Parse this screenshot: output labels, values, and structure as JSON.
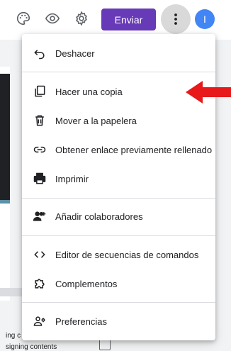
{
  "toolbar": {
    "send_label": "Enviar",
    "avatar_initial": "I",
    "accent_color": "#673ab7",
    "icons": [
      "palette-icon",
      "eye-icon",
      "gear-icon",
      "more-vert-icon"
    ]
  },
  "menu": {
    "items": [
      {
        "label": "Deshacer",
        "icon": "undo-icon"
      },
      {
        "label": "Hacer una copia",
        "icon": "copy-icon"
      },
      {
        "label": "Mover a la papelera",
        "icon": "trash-icon"
      },
      {
        "label": "Obtener enlace previamente rellenado",
        "icon": "link-icon"
      },
      {
        "label": "Imprimir",
        "icon": "print-icon"
      },
      {
        "label": "Añadir colaboradores",
        "icon": "add-people-icon"
      },
      {
        "label": "Editor de secuencias de comandos",
        "icon": "code-icon"
      },
      {
        "label": "Complementos",
        "icon": "puzzle-icon"
      },
      {
        "label": "Preferencias",
        "icon": "preferences-icon"
      }
    ]
  },
  "background": {
    "text_line_1": "ing c",
    "text_line_2": "signing contents"
  },
  "annotation": {
    "arrow_color": "#e8191b"
  }
}
